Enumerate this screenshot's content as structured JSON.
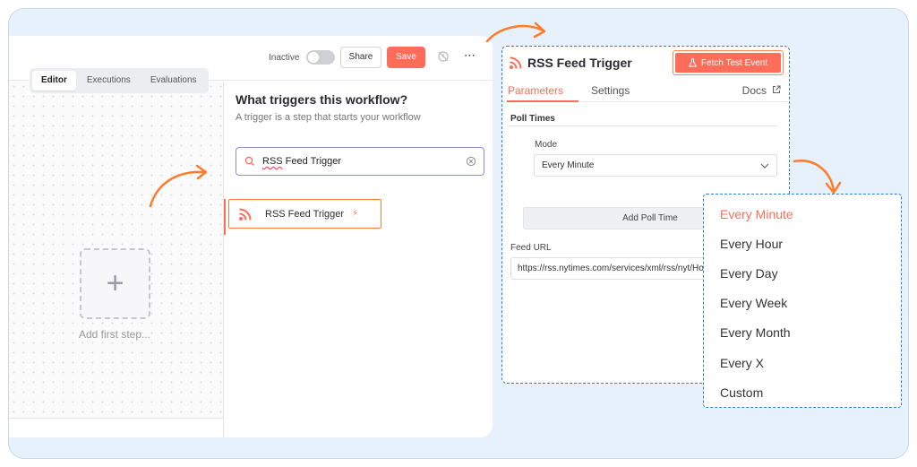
{
  "topbar": {
    "status_label": "Inactive",
    "share_label": "Share",
    "save_label": "Save",
    "more_label": "⋯"
  },
  "tabs": [
    {
      "label": "Editor",
      "active": true
    },
    {
      "label": "Executions",
      "active": false
    },
    {
      "label": "Evaluations",
      "active": false
    }
  ],
  "canvas": {
    "add_step_label": "Add first step..."
  },
  "node_panel": {
    "title": "What triggers this workflow?",
    "subtitle": "A trigger is a step that starts your workflow",
    "search_value_squiggle": "RSS",
    "search_value_rest": " Feed Trigger",
    "result_label": "RSS Feed Trigger",
    "result_icon": "rss-icon",
    "result_badge_icon": "bolt-icon"
  },
  "rss_panel": {
    "title": "RSS Feed Trigger",
    "fetch_label": "Fetch Test Event",
    "tabs": [
      {
        "label": "Parameters",
        "active": true
      },
      {
        "label": "Settings",
        "active": false
      }
    ],
    "docs_label": "Docs",
    "section_title": "Poll Times",
    "mode_label": "Mode",
    "mode_value": "Every Minute",
    "add_poll_label": "Add Poll Time",
    "feed_label": "Feed URL",
    "feed_value": "https://rss.nytimes.com/services/xml/rss/nyt/HomePage.xml"
  },
  "dropdown": {
    "options": [
      {
        "label": "Every Minute",
        "selected": true
      },
      {
        "label": "Every Hour",
        "selected": false
      },
      {
        "label": "Every Day",
        "selected": false
      },
      {
        "label": "Every Week",
        "selected": false
      },
      {
        "label": "Every Month",
        "selected": false
      },
      {
        "label": "Every X",
        "selected": false
      },
      {
        "label": "Custom",
        "selected": false
      }
    ]
  },
  "colors": {
    "accent": "#ff6d5a",
    "highlight_border": "#2f7ad6",
    "arrow": "#ff7a2a",
    "background": "#e6f1fc"
  }
}
